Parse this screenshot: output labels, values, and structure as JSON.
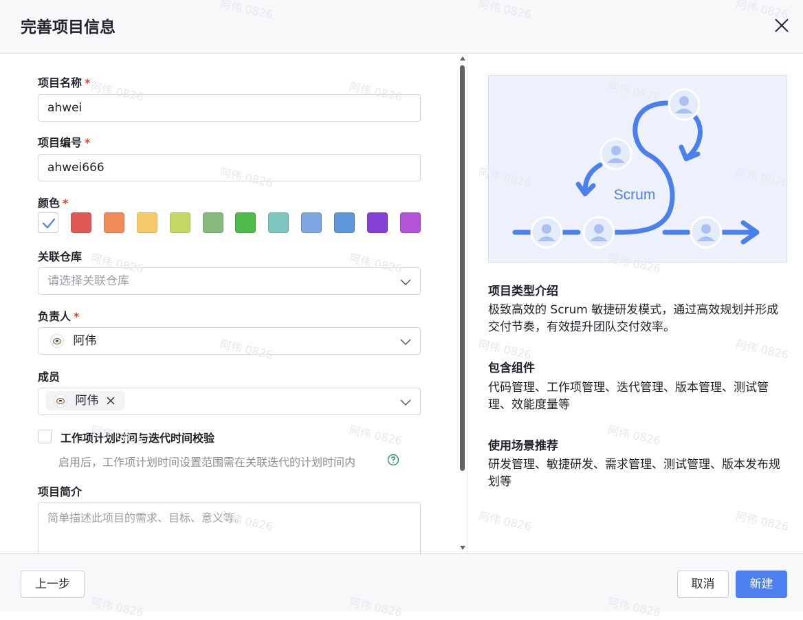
{
  "dialog": {
    "title": "完善项目信息"
  },
  "form": {
    "name": {
      "label": "项目名称",
      "required": "*",
      "value": "ahwei"
    },
    "code": {
      "label": "项目编号",
      "required": "*",
      "value": "ahwei666"
    },
    "color": {
      "label": "颜色",
      "required": "*",
      "swatches": [
        "#ffffff",
        "#e05a55",
        "#ef8c58",
        "#f6c96b",
        "#c5d866",
        "#86ba7d",
        "#4fbc4b",
        "#7ec6bf",
        "#7ea6e1",
        "#5e97da",
        "#8540d5",
        "#b353d8"
      ],
      "selected_index": 0
    },
    "repo": {
      "label": "关联仓库",
      "placeholder": "请选择关联仓库"
    },
    "owner": {
      "label": "负责人",
      "required": "*",
      "value": "阿伟"
    },
    "members": {
      "label": "成员",
      "tags": [
        "阿伟"
      ]
    },
    "check": {
      "label": "工作项计划时间与迭代时间校验",
      "hint": "启用后，工作项计划时间设置范围需在关联迭代的计划时间内",
      "checked": false
    },
    "desc": {
      "label": "项目简介",
      "placeholder": "简单描述此项目的需求、目标、意义等。"
    }
  },
  "info": {
    "illustration_label": "Scrum",
    "type_title": "项目类型介绍",
    "type_text": "极致高效的 Scrum 敏捷研发模式，通过高效规划并形成交付节奏，有效提升团队交付效率。",
    "components_title": "包含组件",
    "components_text": "代码管理、工作项管理、迭代管理、版本管理、测试管理、效能度量等",
    "scenario_title": "使用场景推荐",
    "scenario_text": "研发管理、敏捷研发、需求管理、测试管理、版本发布规划等"
  },
  "footer": {
    "prev": "上一步",
    "cancel": "取消",
    "create": "新建"
  },
  "watermark": "阿伟 0826",
  "colors": {
    "primary": "#4c7ff0",
    "required": "#e0482f",
    "illustration_blue": "#4a80ee"
  }
}
